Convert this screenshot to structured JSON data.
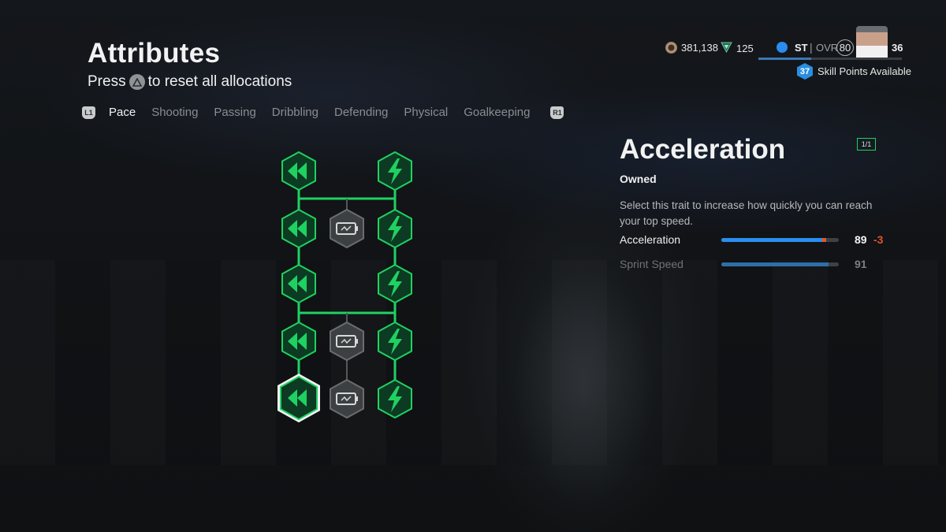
{
  "header": {
    "title": "Attributes",
    "subtitle_prefix": "Press",
    "subtitle_button": "triangle-button",
    "subtitle_suffix": "to reset all allocations"
  },
  "tabs": {
    "left_shoulder": "L1",
    "right_shoulder": "R1",
    "items": [
      {
        "label": "Pace",
        "active": true
      },
      {
        "label": "Shooting",
        "active": false
      },
      {
        "label": "Passing",
        "active": false
      },
      {
        "label": "Dribbling",
        "active": false
      },
      {
        "label": "Defending",
        "active": false
      },
      {
        "label": "Physical",
        "active": false
      },
      {
        "label": "Goalkeeping",
        "active": false
      }
    ]
  },
  "profile": {
    "coins": "381,138",
    "points": "125",
    "position": "ST",
    "separator": "|",
    "ovr_label": "OVR",
    "ovr": "80",
    "level": "36",
    "xp_progress_percent": 37,
    "skill_points": "37",
    "skill_points_label": "Skill Points Available"
  },
  "tree": {
    "colors": {
      "active": "#1fd162",
      "active_fill": "#0d3a22",
      "locked": "#55585b",
      "locked_fill": "#3d4043"
    },
    "left_column_icon": "rewind-icon",
    "right_column_icon": "lightning-bolt-icon",
    "middle_column_icon": "battery-icon",
    "selected_node": "left-5"
  },
  "detail": {
    "title": "Acceleration",
    "level_badge": "1/1",
    "status": "Owned",
    "description": "Select this trait to increase how quickly you can reach your top speed.",
    "stats": [
      {
        "label": "Acceleration",
        "value": "89",
        "delta": "-3",
        "fill_percent": 86,
        "loss_percent": 3,
        "color": "#2b8ef0",
        "highlighted": true
      },
      {
        "label": "Sprint Speed",
        "value": "91",
        "delta": "",
        "fill_percent": 91,
        "loss_percent": 0,
        "color": "#2f6ea8",
        "highlighted": false
      }
    ]
  }
}
